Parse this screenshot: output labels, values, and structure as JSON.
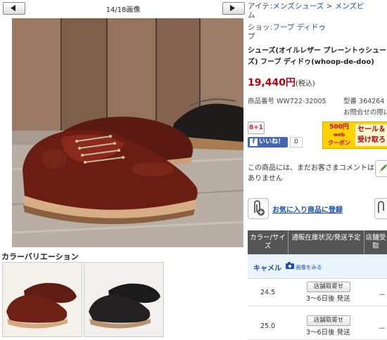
{
  "gallery": {
    "counter": "14/18画像",
    "variation_title": "カラーバリエーション"
  },
  "breadcrumb": {
    "item_label": "アイテム",
    "item_path": [
      ":メンズシューズ",
      ">",
      "メンズビ"
    ],
    "shop_label": "ショップ",
    "shop_name": ":フープ ディドゥ"
  },
  "product": {
    "title": "シューズ(オイルレザー プレーントゥシューズ) フープ ディドゥ(whoop-de-doo)",
    "price": "19,440円",
    "tax_note": "(税込)",
    "product_no": "商品番号 WW722-32005",
    "model_no": "型番 364264",
    "inquiry": "お問合せの際に"
  },
  "social": {
    "gplus": "8+1",
    "fb_like": "いいね！",
    "fb_count": "0"
  },
  "coupon": {
    "amount": "500円",
    "web": "web",
    "label": "クーポン",
    "sale": "セール＆",
    "receive": "受け取ろ"
  },
  "review": {
    "text": "この商品には、まだお客さまコメントはありません"
  },
  "favorite": {
    "label": "お気に入り商品に登録"
  },
  "stock_table": {
    "headers": [
      "カラー/サイズ",
      "通販在庫状況/発送予定",
      "店舗受取"
    ],
    "color_name": "キャメル",
    "color_image_link": "画像をみる",
    "rows": [
      {
        "size": "24.5",
        "store_btn": "店舗取寄せ",
        "ship": "3〜6日後 発送",
        "pickup": "－"
      },
      {
        "size": "25.0",
        "store_btn": "店舗取寄せ",
        "ship": "3〜6日後 発送",
        "pickup": "－"
      }
    ]
  },
  "colors": {
    "accent_link": "#1a4fb3",
    "price_red": "#b8000e",
    "table_header": "#555555",
    "coupon_yellow": "#ffd200"
  }
}
